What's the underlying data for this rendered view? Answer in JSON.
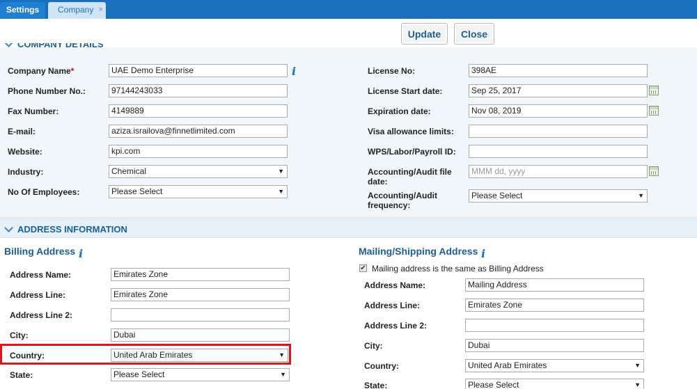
{
  "tabs": [
    {
      "label": "Settings"
    },
    {
      "label": "Company",
      "close": "×"
    }
  ],
  "toolbar": {
    "update_label": "Update",
    "close_label": "Close"
  },
  "company_details": {
    "title": "COMPANY DETAILS",
    "required_mark": "*",
    "left": {
      "company_name": {
        "label": "Company Name",
        "value": "UAE Demo Enterprise"
      },
      "phone": {
        "label": "Phone Number No.:",
        "value": "97144243033"
      },
      "fax": {
        "label": "Fax Number:",
        "value": "4149889"
      },
      "email": {
        "label": "E-mail:",
        "value": "aziza.israilova@finnetlimited.com"
      },
      "website": {
        "label": "Website:",
        "value": "kpi.com"
      },
      "industry": {
        "label": "Industry:",
        "value": "Chemical"
      },
      "employees": {
        "label": "No Of Employees:",
        "value": "Please Select"
      }
    },
    "right": {
      "license_no": {
        "label": "License No:",
        "value": "398AE"
      },
      "license_start": {
        "label": "License Start date:",
        "value": "Sep 25, 2017"
      },
      "expiration": {
        "label": "Expiration date:",
        "value": "Nov 08, 2019"
      },
      "visa": {
        "label": "Visa allowance limits:",
        "value": ""
      },
      "wps": {
        "label": "WPS/Labor/Payroll ID:",
        "value": ""
      },
      "audit_date": {
        "label_line1": "Accounting/Audit file",
        "label_line2": "date:",
        "placeholder": "MMM dd, yyyy"
      },
      "audit_freq": {
        "label_line1": "Accounting/Audit",
        "label_line2": "frequency:",
        "value": "Please Select"
      }
    }
  },
  "address_info": {
    "title": "ADDRESS INFORMATION",
    "billing": {
      "title": "Billing Address",
      "address_name": {
        "label": "Address Name:",
        "value": "Emirates Zone"
      },
      "address_line": {
        "label": "Address Line:",
        "value": "Emirates Zone"
      },
      "address_line2": {
        "label": "Address Line 2:",
        "value": ""
      },
      "city": {
        "label": "City:",
        "value": "Dubai"
      },
      "country": {
        "label": "Country:",
        "value": "United Arab Emirates"
      },
      "state": {
        "label": "State:",
        "value": "Please Select"
      }
    },
    "mailing": {
      "title": "Mailing/Shipping Address",
      "same_as_billing": {
        "label": "Mailing address is the same as Billing Address",
        "checked": true,
        "mark": "✔"
      },
      "address_name": {
        "label": "Address Name:",
        "value": "Mailing Address"
      },
      "address_line": {
        "label": "Address Line:",
        "value": "Emirates Zone"
      },
      "address_line2": {
        "label": "Address Line 2:",
        "value": ""
      },
      "city": {
        "label": "City:",
        "value": "Dubai"
      },
      "country": {
        "label": "Country:",
        "value": "United Arab Emirates"
      },
      "state": {
        "label": "State:",
        "value": "Please Select"
      }
    }
  },
  "icons": {
    "info": "i",
    "dropdown": "▼"
  },
  "colors": {
    "tabbar": "#1a6fbd",
    "accent": "#1a5f99",
    "highlight": "#e0141b",
    "section_bg": "#f1f6fb"
  }
}
